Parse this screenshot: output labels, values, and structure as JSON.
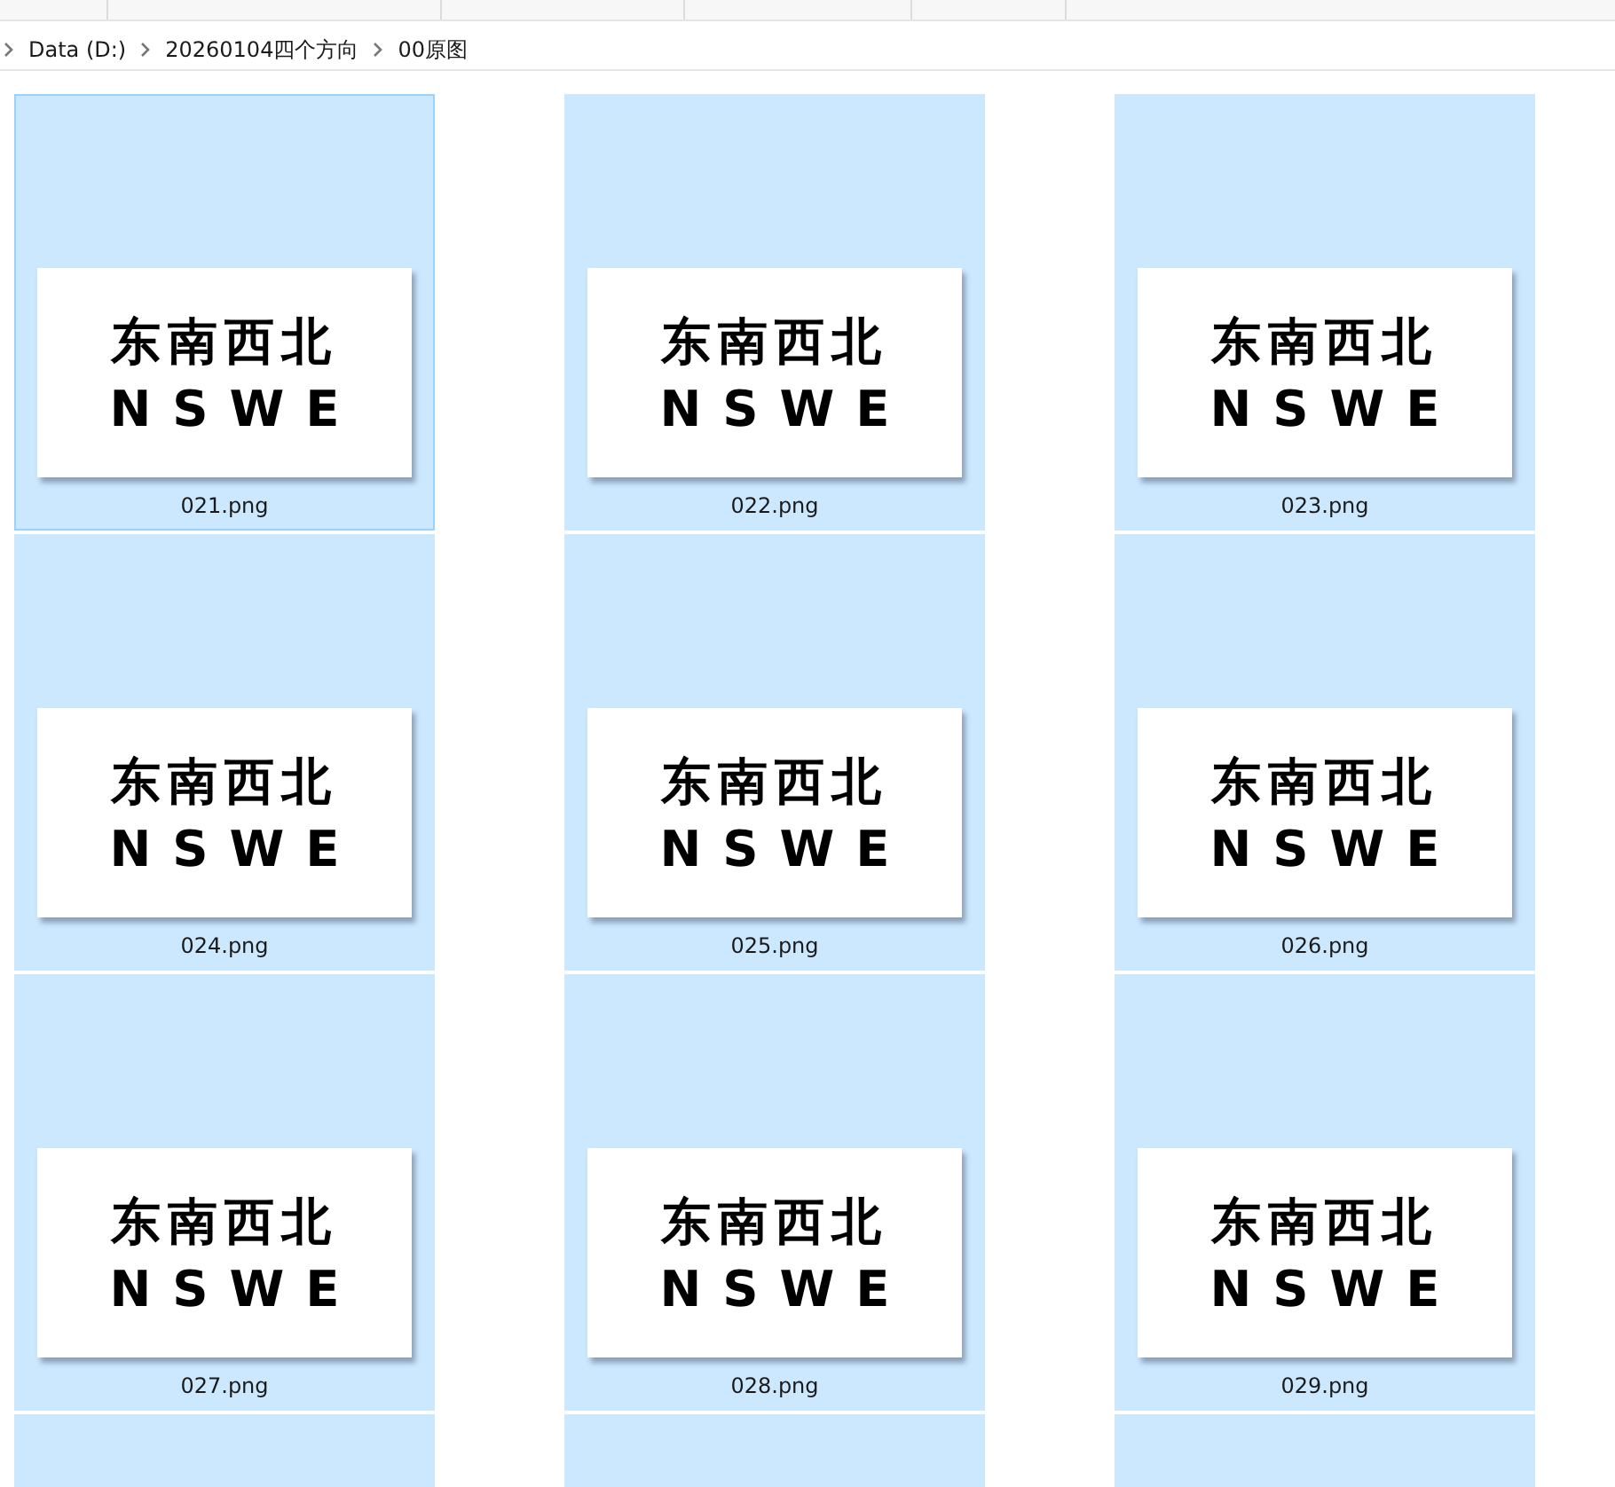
{
  "breadcrumb": [
    "Data (D:)",
    "20260104四个方向",
    "00原图"
  ],
  "files": [
    {
      "name": "021.png",
      "lines": [
        "东南西北",
        "NSWE"
      ],
      "selected": true,
      "focused": true
    },
    {
      "name": "022.png",
      "lines": [
        "东南西北",
        "NSWE"
      ],
      "selected": true,
      "focused": false
    },
    {
      "name": "023.png",
      "lines": [
        "东南西北",
        "NSWE"
      ],
      "selected": true,
      "focused": false
    },
    {
      "name": "024.png",
      "lines": [
        "东南西北",
        "NSWE"
      ],
      "selected": true,
      "focused": false
    },
    {
      "name": "025.png",
      "lines": [
        "东南西北",
        "NSWE"
      ],
      "selected": true,
      "focused": false
    },
    {
      "name": "026.png",
      "lines": [
        "东南西北",
        "NSWE"
      ],
      "selected": true,
      "focused": false
    },
    {
      "name": "027.png",
      "lines": [
        "东南西北",
        "NSWE"
      ],
      "selected": true,
      "focused": false
    },
    {
      "name": "028.png",
      "lines": [
        "东南西北",
        "NSWE"
      ],
      "selected": true,
      "focused": false
    },
    {
      "name": "029.png",
      "lines": [
        "东南西北",
        "NSWE"
      ],
      "selected": true,
      "focused": false
    }
  ],
  "partial_row": [
    {
      "selected": true
    },
    {
      "selected": true
    },
    {
      "selected": true
    }
  ]
}
